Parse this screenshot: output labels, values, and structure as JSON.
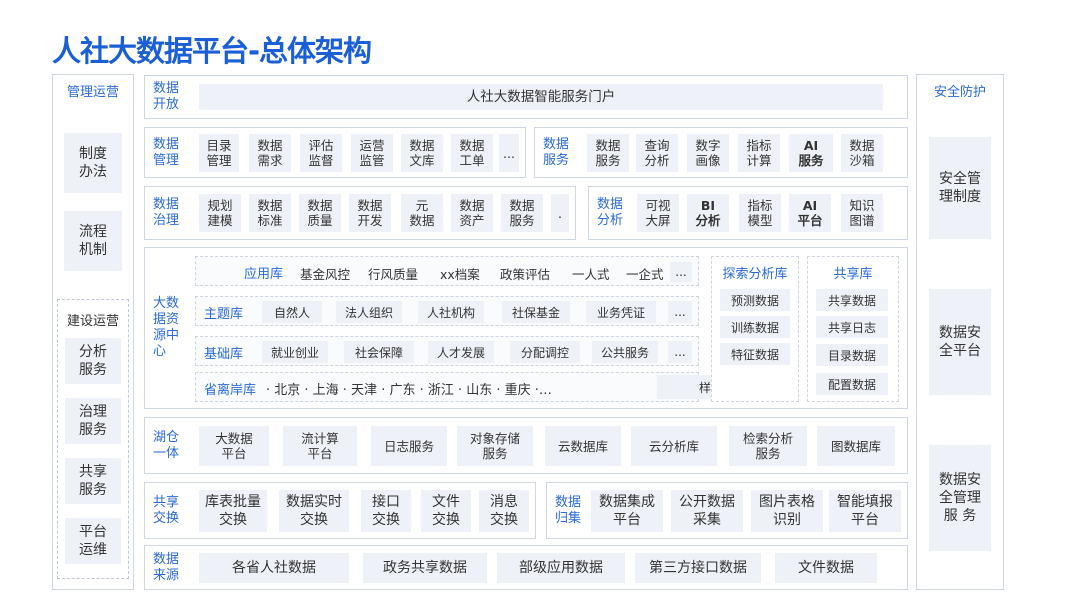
{
  "title": "人社大数据平台-总体架构",
  "left": {
    "title": "管理运营",
    "items": [
      "制度\n办法",
      "流程\n机制"
    ],
    "build_title": "建设运营",
    "build_items": [
      "分析\n服务",
      "治理\n服务",
      "共享\n服务",
      "平台\n运维"
    ]
  },
  "right": {
    "title": "安全防护",
    "items": [
      "安全管\n理制度",
      "数据安\n全平台",
      "数据安\n全管理\n服 务"
    ]
  },
  "open": {
    "label": "数据\n开放",
    "portal": "人社大数据智能服务门户"
  },
  "manage": {
    "label": "数据\n管理",
    "items": [
      "目录\n管理",
      "数据\n需求",
      "评估\n监督",
      "运营\n监管",
      "数据\n文库",
      "数据\n工单",
      "..."
    ]
  },
  "service": {
    "label": "数据\n服务",
    "items": [
      "数据\n服务",
      "查询\n分析",
      "数字\n画像",
      "指标\n计算",
      "AI\n服务",
      "数据\n沙箱"
    ]
  },
  "govern": {
    "label": "数据\n治理",
    "items": [
      "规划\n建模",
      "数据\n标准",
      "数据\n质量",
      "数据\n开发",
      "元\n数据",
      "数据\n资产",
      "数据\n服务",
      "."
    ]
  },
  "analysis": {
    "label": "数据\n分析",
    "items": [
      "可视\n大屏",
      "BI\n分析",
      "指标\n模型",
      "AI\n平台",
      "知识\n图谱"
    ]
  },
  "resource": {
    "label": "大数\n据资\n源中\n心",
    "app": {
      "label": "应用库",
      "items": [
        "基金风控",
        "行风质量",
        "xx档案",
        "政策评估",
        "一人式",
        "一企式",
        "..."
      ]
    },
    "theme": {
      "label": "主题库",
      "items": [
        "自然人",
        "法人组织",
        "人社机构",
        "社保基金",
        "业务凭证",
        "..."
      ]
    },
    "base": {
      "label": "基础库",
      "items": [
        "就业创业",
        "社会保障",
        "人才发展",
        "分配调控",
        "公共服务",
        "..."
      ]
    },
    "province": {
      "label": "省离岸库",
      "text": "· 北京 · 上海 · 天津 · 广东 · 浙江 · 山东 · 重庆 ·…",
      "sample": "样本数据"
    },
    "explore": {
      "label": "探索分析库",
      "items": [
        "预测数据",
        "训练数据",
        "特征数据"
      ]
    },
    "share": {
      "label": "共享库",
      "items": [
        "共享数据",
        "共享日志",
        "目录数据",
        "配置数据"
      ]
    }
  },
  "lake": {
    "label": "湖仓\n一体",
    "items": [
      "大数据\n平台",
      "流计算\n平台",
      "日志服务",
      "对象存储\n服务",
      "云数据库",
      "云分析库",
      "检索分析\n服务",
      "图数据库"
    ]
  },
  "exchange": {
    "label": "共享\n交换",
    "items": [
      "库表批量\n交换",
      "数据实时\n交换",
      "接口\n交换",
      "文件\n交换",
      "消息\n交换"
    ]
  },
  "collect": {
    "label": "数据\n归集",
    "items": [
      "数据集成\n平台",
      "公开数据\n采集",
      "图片表格\n识别",
      "智能填报\n平台"
    ]
  },
  "source": {
    "label": "数据\n来源",
    "items": [
      "各省人社数据",
      "政务共享数据",
      "部级应用数据",
      "第三方接口数据",
      "文件数据"
    ]
  },
  "colors": {
    "accent": "#2a6ad6",
    "title": "#1b5fd6",
    "box": "#eef1f7",
    "border": "#cfd6e4"
  }
}
